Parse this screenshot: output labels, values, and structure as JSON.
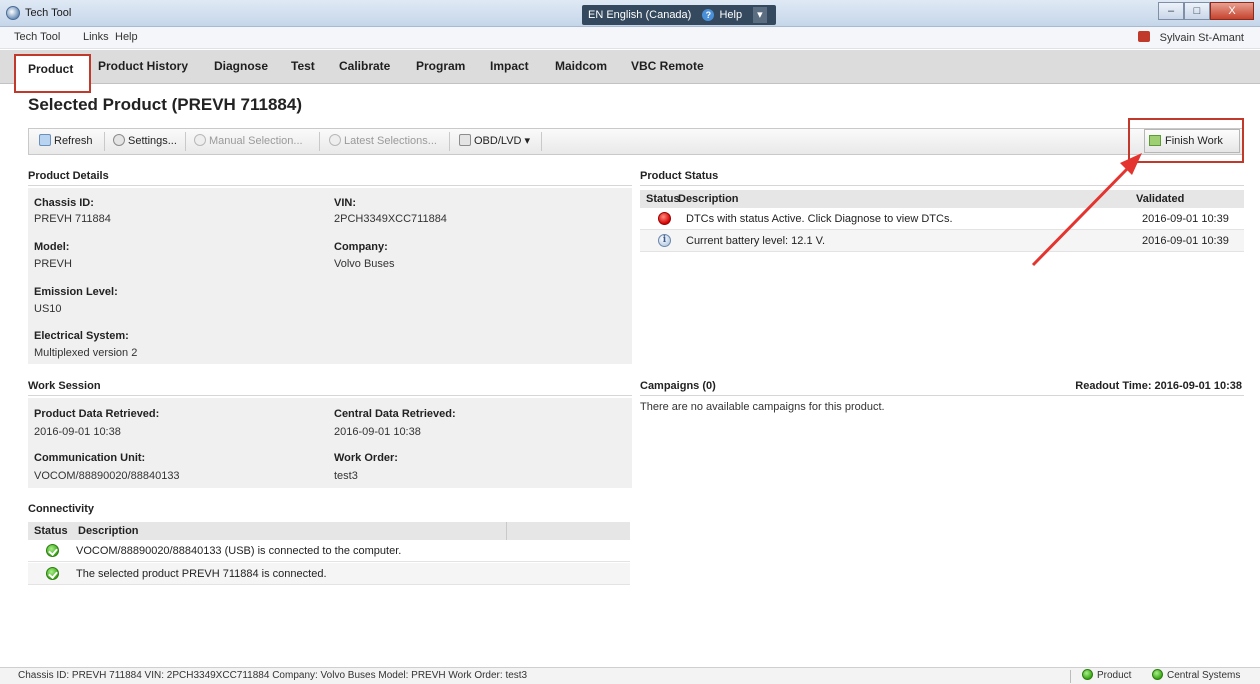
{
  "window": {
    "title": "Tech Tool",
    "language": "EN English (Canada)",
    "help": "Help",
    "controls": [
      "–",
      "□",
      "X"
    ]
  },
  "menu": {
    "items": [
      "Tech Tool",
      "Links",
      "Help"
    ],
    "user": "Sylvain St-Amant"
  },
  "tabs": [
    "Product",
    "Product History",
    "Diagnose",
    "Test",
    "Calibrate",
    "Program",
    "Impact",
    "Maidcom",
    "VBC Remote"
  ],
  "page_title": "Selected Product (PREVH 711884)",
  "toolbar": {
    "refresh": "Refresh",
    "settings": "Settings...",
    "manual_selection": "Manual Selection...",
    "latest_selections": "Latest Selections...",
    "obd": "OBD/LVD ▾",
    "finish_work": "Finish Work"
  },
  "product_details": {
    "header": "Product Details",
    "chassis_id_label": "Chassis ID:",
    "chassis_id": "PREVH 711884",
    "vin_label": "VIN:",
    "vin": "2PCH3349XCC711884",
    "model_label": "Model:",
    "model": "PREVH",
    "company_label": "Company:",
    "company": "Volvo Buses",
    "emission_label": "Emission Level:",
    "emission": "US10",
    "electrical_label": "Electrical System:",
    "electrical": "Multiplexed version 2"
  },
  "product_status": {
    "header": "Product Status",
    "columns": [
      "Status",
      "Description",
      "Validated"
    ],
    "rows": [
      {
        "icon": "error-icon",
        "description": "DTCs with status Active. Click Diagnose to view DTCs.",
        "validated": "2016-09-01 10:39"
      },
      {
        "icon": "info-icon",
        "description": "Current battery level: 12.1 V.",
        "validated": "2016-09-01 10:39"
      }
    ]
  },
  "work_session": {
    "header": "Work Session",
    "product_data_label": "Product Data Retrieved:",
    "product_data": "2016-09-01 10:38",
    "central_data_label": "Central Data Retrieved:",
    "central_data": "2016-09-01 10:38",
    "comm_unit_label": "Communication Unit:",
    "comm_unit": "VOCOM/88890020/88840133",
    "work_order_label": "Work Order:",
    "work_order": "test3"
  },
  "campaigns": {
    "header": "Campaigns  (0)",
    "readout": "Readout Time:  2016-09-01 10:38",
    "message": "There are no available campaigns for this product."
  },
  "connectivity": {
    "header": "Connectivity",
    "columns": [
      "Status",
      "Description"
    ],
    "rows": [
      {
        "icon": "check-icon",
        "description": "VOCOM/88890020/88840133 (USB) is connected to the computer."
      },
      {
        "icon": "check-icon",
        "description": "The selected product PREVH 711884 is connected."
      }
    ]
  },
  "statusbar": {
    "info": "Chassis ID: PREVH 711884    VIN: 2PCH3349XCC711884    Company: Volvo Buses    Model: PREVH    Work Order: test3",
    "product": "Product",
    "central": "Central Systems"
  },
  "colors": {
    "highlight": "#c0392b",
    "ok": "#3aa614",
    "error": "#d50000"
  }
}
